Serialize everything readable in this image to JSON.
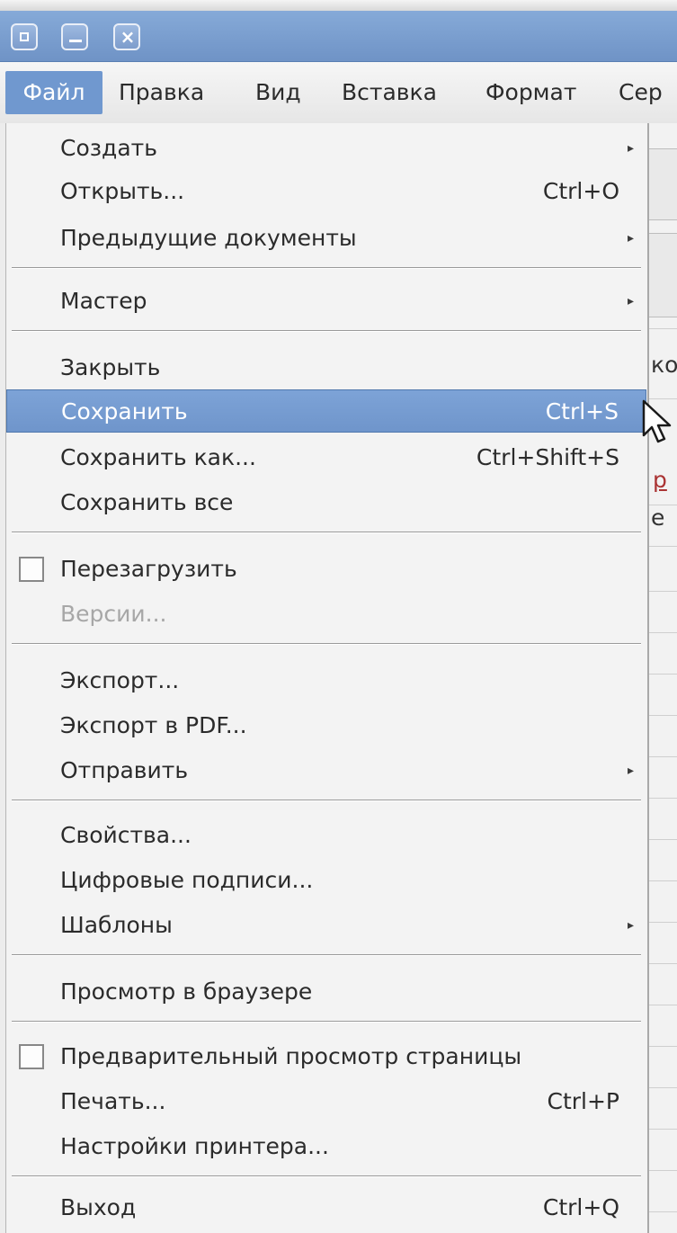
{
  "window": {
    "buttons": [
      {
        "name": "menu-icon"
      },
      {
        "name": "minimize-icon"
      },
      {
        "name": "close-icon",
        "glyph": "×"
      }
    ]
  },
  "menubar": {
    "items": [
      {
        "label": "Файл",
        "active": true
      },
      {
        "label": "Правка"
      },
      {
        "label": "Вид"
      },
      {
        "label": "Вставка"
      },
      {
        "label": "Формат"
      },
      {
        "label": "Сер"
      }
    ]
  },
  "background_fragments": {
    "frag1": "ко",
    "frag2": "р",
    "frag3": "е"
  },
  "file_menu": {
    "items": [
      {
        "label": "Создать",
        "submenu": true
      },
      {
        "label": "Открыть...",
        "accel": "Ctrl+O"
      },
      {
        "label": "Предыдущие документы",
        "submenu": true
      },
      {
        "label": "Мастер",
        "submenu": true
      },
      {
        "label": "Закрыть"
      },
      {
        "label": "Сохранить",
        "accel": "Ctrl+S",
        "highlighted": true
      },
      {
        "label": "Сохранить как...",
        "accel": "Ctrl+Shift+S"
      },
      {
        "label": "Сохранить все"
      },
      {
        "label": "Перезагрузить",
        "checkbox": true
      },
      {
        "label": "Версии...",
        "disabled": true
      },
      {
        "label": "Экспорт..."
      },
      {
        "label": "Экспорт в PDF..."
      },
      {
        "label": "Отправить",
        "submenu": true
      },
      {
        "label": "Свойства..."
      },
      {
        "label": "Цифровые подписи..."
      },
      {
        "label": "Шаблоны",
        "submenu": true
      },
      {
        "label": "Просмотр в браузере"
      },
      {
        "label": "Предварительный просмотр страницы",
        "checkbox": true
      },
      {
        "label": "Печать...",
        "accel": "Ctrl+P"
      },
      {
        "label": "Настройки принтера..."
      },
      {
        "label": "Выход",
        "accel": "Ctrl+Q"
      }
    ],
    "submenu_arrow": "▸"
  },
  "colors": {
    "titlebar": "#7c9fd0",
    "highlight": "#7098cf",
    "menu_bg": "#f3f3f3",
    "disabled_text": "#a7a7a7"
  }
}
